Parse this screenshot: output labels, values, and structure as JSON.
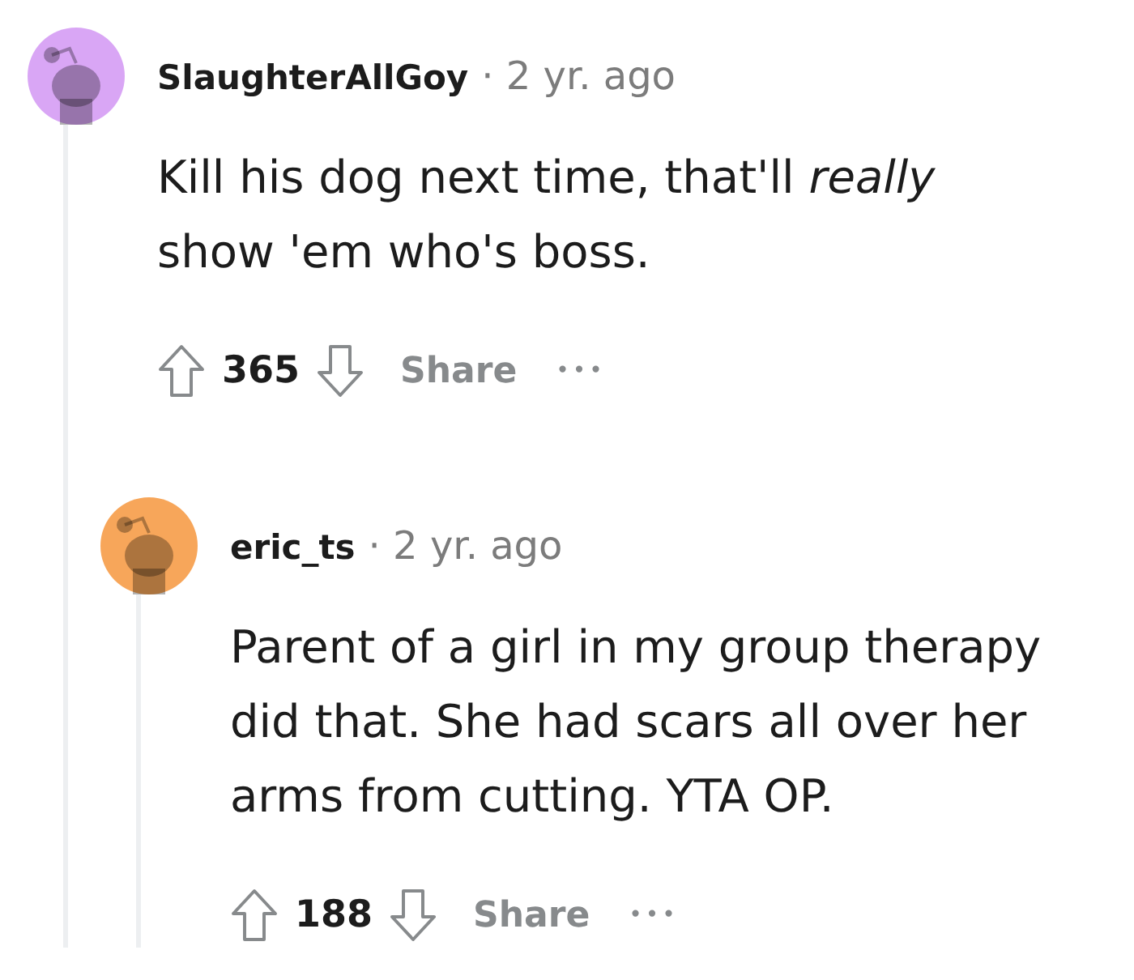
{
  "comments": [
    {
      "author": "SlaughterAllGoy",
      "age": "· 2 yr. ago",
      "color": "#d9a6f5",
      "body": "Kill his dog next time, that'll *really* show 'em who's boss.",
      "score": "365",
      "share": "Share",
      "more": "•••",
      "children": [
        {
          "author": "eric_ts",
          "age": "· 2 yr. ago",
          "color": "#f7a65a",
          "body": "Parent of a girl in my group therapy did that. She had scars all over her arms from cutting. YTA OP.",
          "score": "188",
          "share": "Share",
          "more": "•••"
        }
      ]
    }
  ]
}
